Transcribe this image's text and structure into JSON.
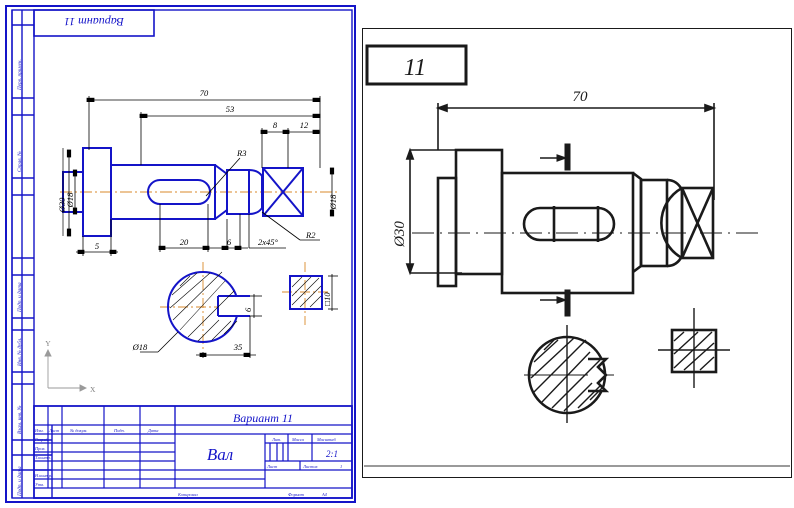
{
  "app": {
    "left_panel_name": "cad-drawing-canvas",
    "right_panel_name": "scanned-reference-sheet"
  },
  "colors": {
    "cad_line": "#1414c8",
    "dim_line": "#000000",
    "axis_line": "#d98a2b",
    "scan_line": "#1a1a1a",
    "paper": "#ffffff"
  },
  "cad_sheet": {
    "variant_box_label": "Вариант 11",
    "left_margin_labels": [
      "Перв. примен.",
      "Справ. №",
      "Подп. и дата",
      "Инв. № дубл.",
      "Взам. инв. №",
      "Подп. и дата",
      "Инв. № подл."
    ],
    "axis_indicator": {
      "x_label": "X",
      "y_label": "Y"
    }
  },
  "drawing": {
    "title": "Вал",
    "dimensions": {
      "overall_length": "70",
      "length_53": "53",
      "length_8": "8",
      "length_12": "12",
      "length_5": "5",
      "keyway_length": "20",
      "keyway_offset": "6",
      "chamfer": "2x45°",
      "dia_large": "Ø30",
      "dia_mid": "Ø18",
      "dia_right": "Ø18",
      "radius_r3": "R3",
      "radius_r2": "R2"
    },
    "section_a": {
      "diameter_label": "Ø18",
      "keyway_depth": "6",
      "position": "35"
    },
    "section_b": {
      "square_label": "□10"
    }
  },
  "title_block": {
    "header_row": [
      "Изм.",
      "Лист",
      "№ докум.",
      "Подп.",
      "Дата"
    ],
    "role_rows": [
      "Разраб.",
      "Пров.",
      "Т.контр.",
      "",
      "Н.контр.",
      "Утв."
    ],
    "variant_cell": "Вариант 11",
    "part_name": "Вал",
    "lit_label": "Лит.",
    "mass_label": "Масса",
    "scale_label": "Масштаб",
    "scale_value": "2:1",
    "sheet_label": "Лист",
    "sheets_label": "Листов",
    "sheets_value": "1",
    "copy_label": "Копировал",
    "format_label": "Формат",
    "format_value": "А4"
  },
  "scan_sheet": {
    "variant_number": "11",
    "overall_length": "70",
    "diameter": "Ø30"
  }
}
